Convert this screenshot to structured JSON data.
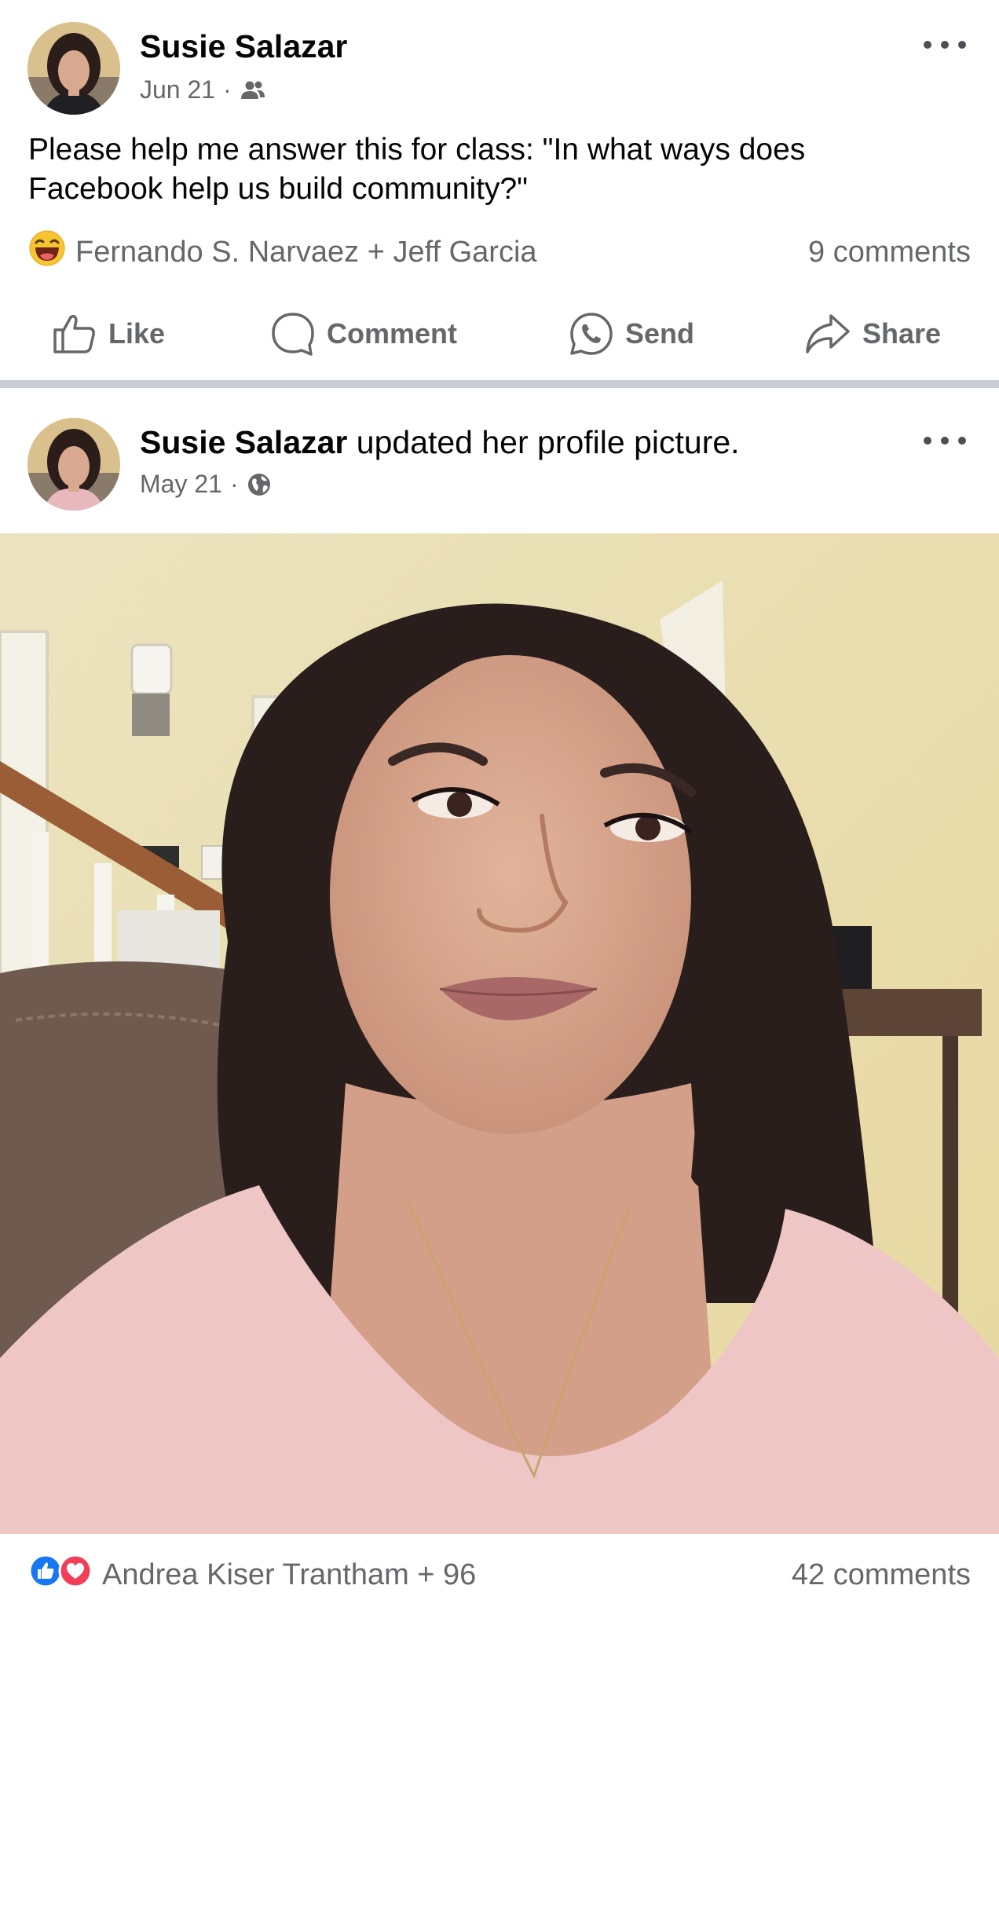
{
  "post1": {
    "author": "Susie Salazar",
    "date": "Jun 21",
    "separator": "·",
    "audience_icon": "friends-icon",
    "text_line1": "Please help me answer this for class:  \"In what ways does",
    "text_line2": "Facebook help us build community?\"",
    "reaction_icon": "haha-emoji-icon",
    "reactors": "Fernando S. Narvaez + Jeff Garcia",
    "comments": "9 comments",
    "actions": {
      "like": "Like",
      "comment": "Comment",
      "send": "Send",
      "share": "Share"
    }
  },
  "post2": {
    "author": "Susie Salazar",
    "action_text": " updated her profile picture.",
    "date": "May 21",
    "separator": "·",
    "audience_icon": "globe-icon",
    "reaction_icons": [
      "like-reaction-icon",
      "love-reaction-icon"
    ],
    "reactors": "Andrea Kiser Trantham + 96",
    "comments": "42 comments"
  },
  "colors": {
    "text_primary": "#050505",
    "text_secondary": "#65676b",
    "divider": "#c9ccd1",
    "like_blue": "#1877f2",
    "love_red": "#f33e58"
  }
}
